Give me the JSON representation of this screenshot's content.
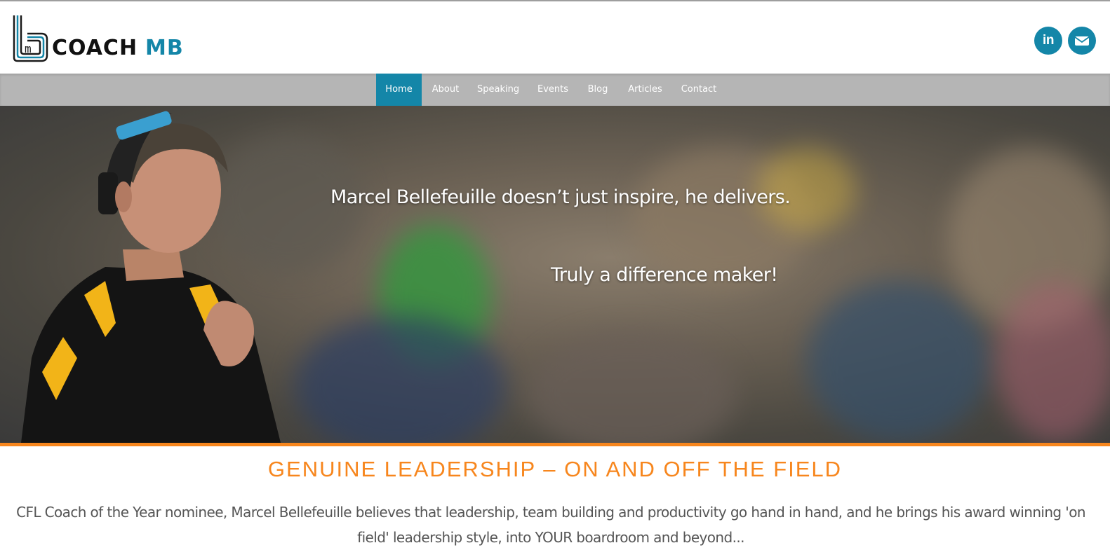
{
  "brand": {
    "logo_mark": "m",
    "logo_text_dark": "COACH",
    "logo_text_accent": "MB",
    "accent_color": "#1486a8",
    "orange_color": "#f7861d"
  },
  "social": [
    {
      "icon": "linkedin-icon",
      "glyph": "in"
    },
    {
      "icon": "envelope-icon"
    }
  ],
  "nav": {
    "items": [
      {
        "label": "Home",
        "active": true
      },
      {
        "label": "About"
      },
      {
        "label": "Speaking"
      },
      {
        "label": "Events"
      },
      {
        "label": "Blog"
      },
      {
        "label": "Articles"
      },
      {
        "label": "Contact"
      }
    ]
  },
  "hero": {
    "line1": "Marcel Bellefeuille doesn’t just inspire, he delivers.",
    "line2": "Truly a difference maker!"
  },
  "main": {
    "headline": "GENUINE LEADERSHIP – ON AND OFF THE FIELD",
    "intro": "CFL Coach of the Year nominee, Marcel Bellefeuille believes that leadership, team building and productivity go hand in hand, and he brings his award winning 'on field' leadership style, into YOUR boardroom and beyond..."
  }
}
